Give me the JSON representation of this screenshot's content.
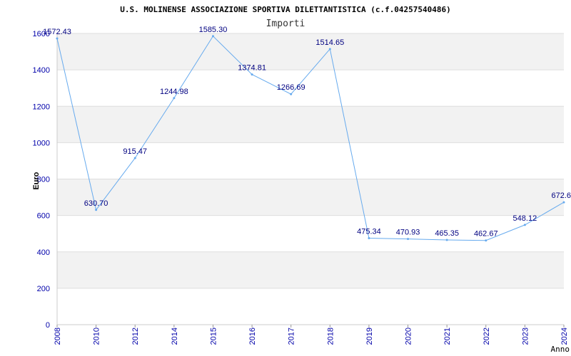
{
  "chart_data": {
    "type": "line",
    "title": "U.S. MOLINENSE ASSOCIAZIONE SPORTIVA DILETTANTISTICA (c.f.04257540486)",
    "subtitle": "Importi",
    "xlabel": "Anno",
    "ylabel": "Euro",
    "ylim": [
      0,
      1600
    ],
    "yticks": [
      0,
      200,
      400,
      600,
      800,
      1000,
      1200,
      1400,
      1600
    ],
    "grid": true,
    "categories": [
      "2008",
      "2010",
      "2012",
      "2014",
      "2015",
      "2016",
      "2017",
      "2018",
      "2019",
      "2020",
      "2021",
      "2022",
      "2023",
      "2024"
    ],
    "series": [
      {
        "values": [
          1572.43,
          630.7,
          915.47,
          1244.98,
          1585.3,
          1374.81,
          1266.69,
          1514.65,
          475.34,
          470.93,
          465.35,
          462.67,
          548.12,
          672.6
        ],
        "labels": [
          "1572.43",
          "630.70",
          "915.47",
          "1244.98",
          "1585.30",
          "1374.81",
          "1266.69",
          "1514.65",
          "475.34",
          "470.93",
          "465.35",
          "462.67",
          "548.12",
          "672.6"
        ],
        "color": "#66aaee"
      }
    ],
    "colors": {
      "band": "#f2f2f2",
      "grid": "#dddddd",
      "tick_text": "#0000aa",
      "label_text": "#000080"
    }
  }
}
